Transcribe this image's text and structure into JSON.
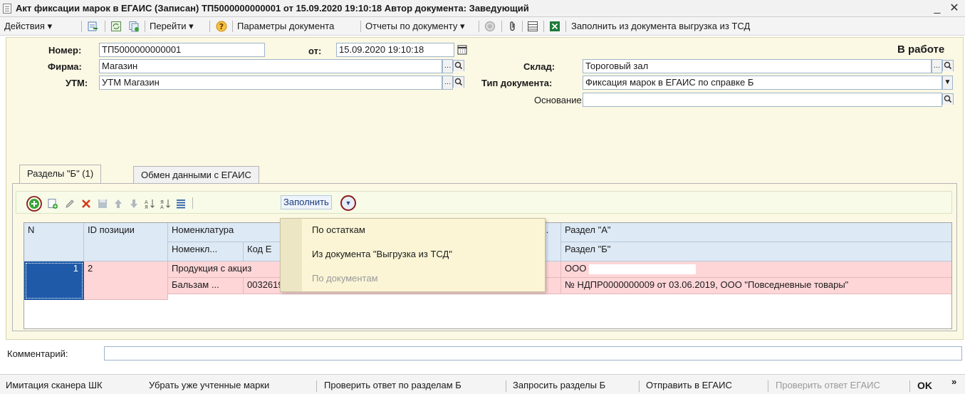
{
  "window": {
    "title": "Акт фиксации марок в ЕГАИС (Записан)  ТП5000000000001 от 15.09.2020 19:10:18 Автор документа: Заведующий",
    "minimize": "_",
    "close": "✕"
  },
  "toolbar": {
    "actions": "Действия ▾",
    "goto": "Перейти ▾",
    "doc_params": "Параметры документа",
    "reports": "Отчеты по документу ▾",
    "fill_from_tsd": "Заполнить из документа выгрузка из ТСД"
  },
  "header": {
    "number_label": "Номер:",
    "number_value": "ТП5000000000001",
    "date_label": "от:",
    "date_value": "15.09.2020 19:10:18",
    "status": "В работе",
    "firm_label": "Фирма:",
    "firm_value": "Магазин",
    "warehouse_label": "Склад:",
    "warehouse_value": "Тороговый зал",
    "utm_label": "УТМ:",
    "utm_value": "УТМ Магазин",
    "doc_type_label": "Тип документа:",
    "doc_type_value": "Фиксация марок в ЕГАИС по справке Б",
    "basis_label": "Основание:",
    "basis_value": ""
  },
  "tabs": [
    {
      "label": "Разделы \"Б\" (1)"
    },
    {
      "label": "Обмен данными с ЕГАИС"
    }
  ],
  "innerbar": {
    "fill_label": "Заполнить"
  },
  "grid": {
    "headers": {
      "n": "N",
      "id": "ID позиции",
      "nomen": "Номенклатура",
      "nomen_short": "Номенкл...",
      "code": "Код Е",
      "dots": "..",
      "section_a": "Раздел \"А\"",
      "section_b": "Раздел \"Б\""
    },
    "row": {
      "n": "1",
      "id": "2",
      "product": "Продукция с акциз",
      "nomen_short": "Бальзам ...",
      "code": "0032619000001242225",
      "section_a": "ООО",
      "section_b": "№ НДПР0000000009 от 03.06.2019, ООО \"Повседневные товары\""
    }
  },
  "menu": {
    "items": [
      {
        "label": "По остаткам",
        "enabled": true
      },
      {
        "label": "Из документа \"Выгрузка из ТСД\"",
        "enabled": true
      },
      {
        "label": "По документам",
        "enabled": false
      }
    ]
  },
  "comment": {
    "label": "Комментарий:",
    "value": ""
  },
  "statusbar": {
    "scanner": "Имитация сканера ШК",
    "remove_marks": "Убрать уже учтенные марки",
    "check_b": "Проверить ответ по разделам Б",
    "request_b": "Запросить разделы Б",
    "send": "Отправить в ЕГАИС",
    "check_egais": "Проверить ответ ЕГАИС",
    "ok": "OK",
    "more": "»"
  },
  "colors": {
    "form_bg": "#fbf8e4",
    "header_bg": "#dde9f5",
    "row_bg": "#ffd6d8",
    "selected_cell": "#1e5aa8",
    "highlight_ring": "#8b1a1a"
  }
}
